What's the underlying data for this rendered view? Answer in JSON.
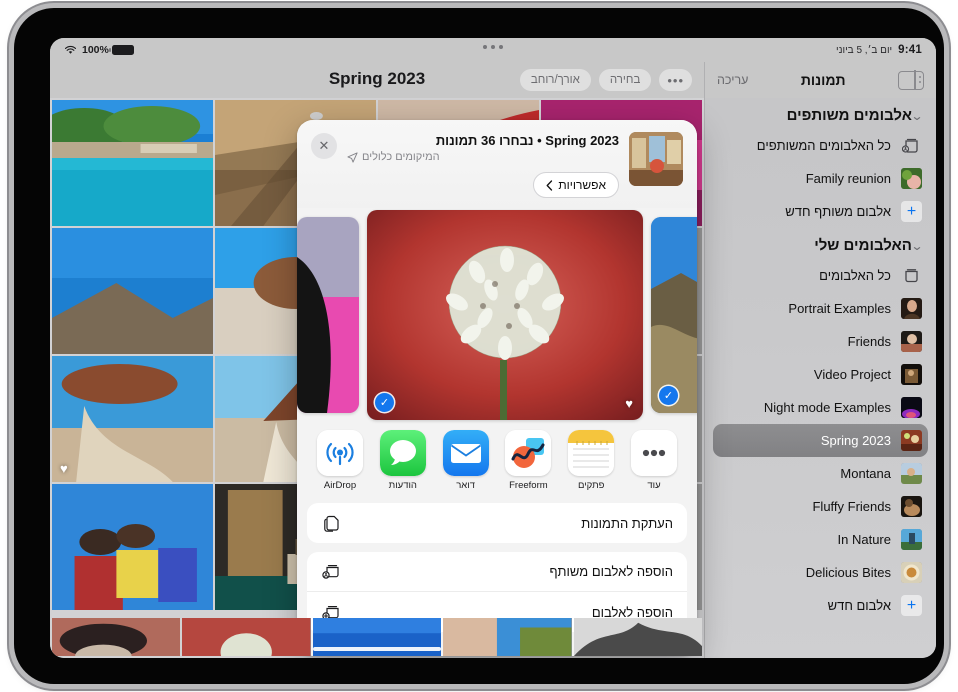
{
  "status_bar": {
    "battery_pct": "100%",
    "time": "9:41",
    "date": "יום ב׳, 5 ביוני",
    "wifi_icon": "wifi-icon",
    "battery_icon": "battery-full-icon"
  },
  "photos_toolbar": {
    "aspect_label": "אורך/רוחב",
    "select_label": "בחירה",
    "more_label": "•••",
    "album_title": "Spring 2023"
  },
  "sidebar": {
    "title": "תמונות",
    "edit_label": "עריכה",
    "toggle_icon": "sidebar-toggle-icon",
    "sections": [
      {
        "header": "אלבומים משותפים",
        "items": [
          {
            "label": "כל האלבומים המשותפים",
            "icon": "shared-albums-icon"
          },
          {
            "label": "Family reunion",
            "icon": "album-thumbnail"
          },
          {
            "label": "אלבום משותף חדש",
            "icon": "plus-icon"
          }
        ]
      },
      {
        "header": "האלבומים שלי",
        "items": [
          {
            "label": "כל האלבומים",
            "icon": "albums-icon"
          },
          {
            "label": "Portrait Examples",
            "icon": "album-thumbnail"
          },
          {
            "label": "Friends",
            "icon": "album-thumbnail"
          },
          {
            "label": "Video Project",
            "icon": "album-thumbnail"
          },
          {
            "label": "Night mode Examples",
            "icon": "album-thumbnail"
          },
          {
            "label": "Spring 2023",
            "icon": "album-thumbnail",
            "selected": true
          },
          {
            "label": "Montana",
            "icon": "album-thumbnail"
          },
          {
            "label": "Fluffy Friends",
            "icon": "album-thumbnail"
          },
          {
            "label": "In Nature",
            "icon": "album-thumbnail"
          },
          {
            "label": "Delicious Bites",
            "icon": "album-thumbnail"
          },
          {
            "label": "אלבום חדש",
            "icon": "plus-icon"
          }
        ]
      }
    ]
  },
  "share_sheet": {
    "close_icon": "close-icon",
    "title": "Spring 2023 • נבחרו 36 תמונות",
    "subtitle": "המיקומים כלולים",
    "subtitle_icon": "location-arrow-icon",
    "options_label": "אפשרויות",
    "options_chevron": "chevron-left-icon",
    "carousel": [
      {
        "selected": false,
        "favorite": false,
        "position": "left"
      },
      {
        "selected": true,
        "favorite": true,
        "position": "center"
      },
      {
        "selected": true,
        "favorite": false,
        "position": "right"
      }
    ],
    "apps": [
      {
        "name": "עוד",
        "icon": "more-icon"
      },
      {
        "name": "פתקים",
        "icon": "notes-icon"
      },
      {
        "name": "Freeform",
        "icon": "freeform-icon"
      },
      {
        "name": "דואר",
        "icon": "mail-icon"
      },
      {
        "name": "הודעות",
        "icon": "messages-icon"
      },
      {
        "name": "AirDrop",
        "icon": "airdrop-icon"
      }
    ],
    "actions_group_1": [
      {
        "label": "העתקת התמונות",
        "icon": "copy-icon"
      }
    ],
    "actions_group_2": [
      {
        "label": "הוספה לאלבום משותף",
        "icon": "add-to-shared-album-icon"
      },
      {
        "label": "הוספה לאלבום",
        "icon": "add-to-album-icon"
      }
    ]
  },
  "colors": {
    "accent_blue": "#1477ee",
    "selected_row": "#868689",
    "sheet_bg": "#f3f3f3",
    "sidebar_bg": "#c8c8ca"
  }
}
